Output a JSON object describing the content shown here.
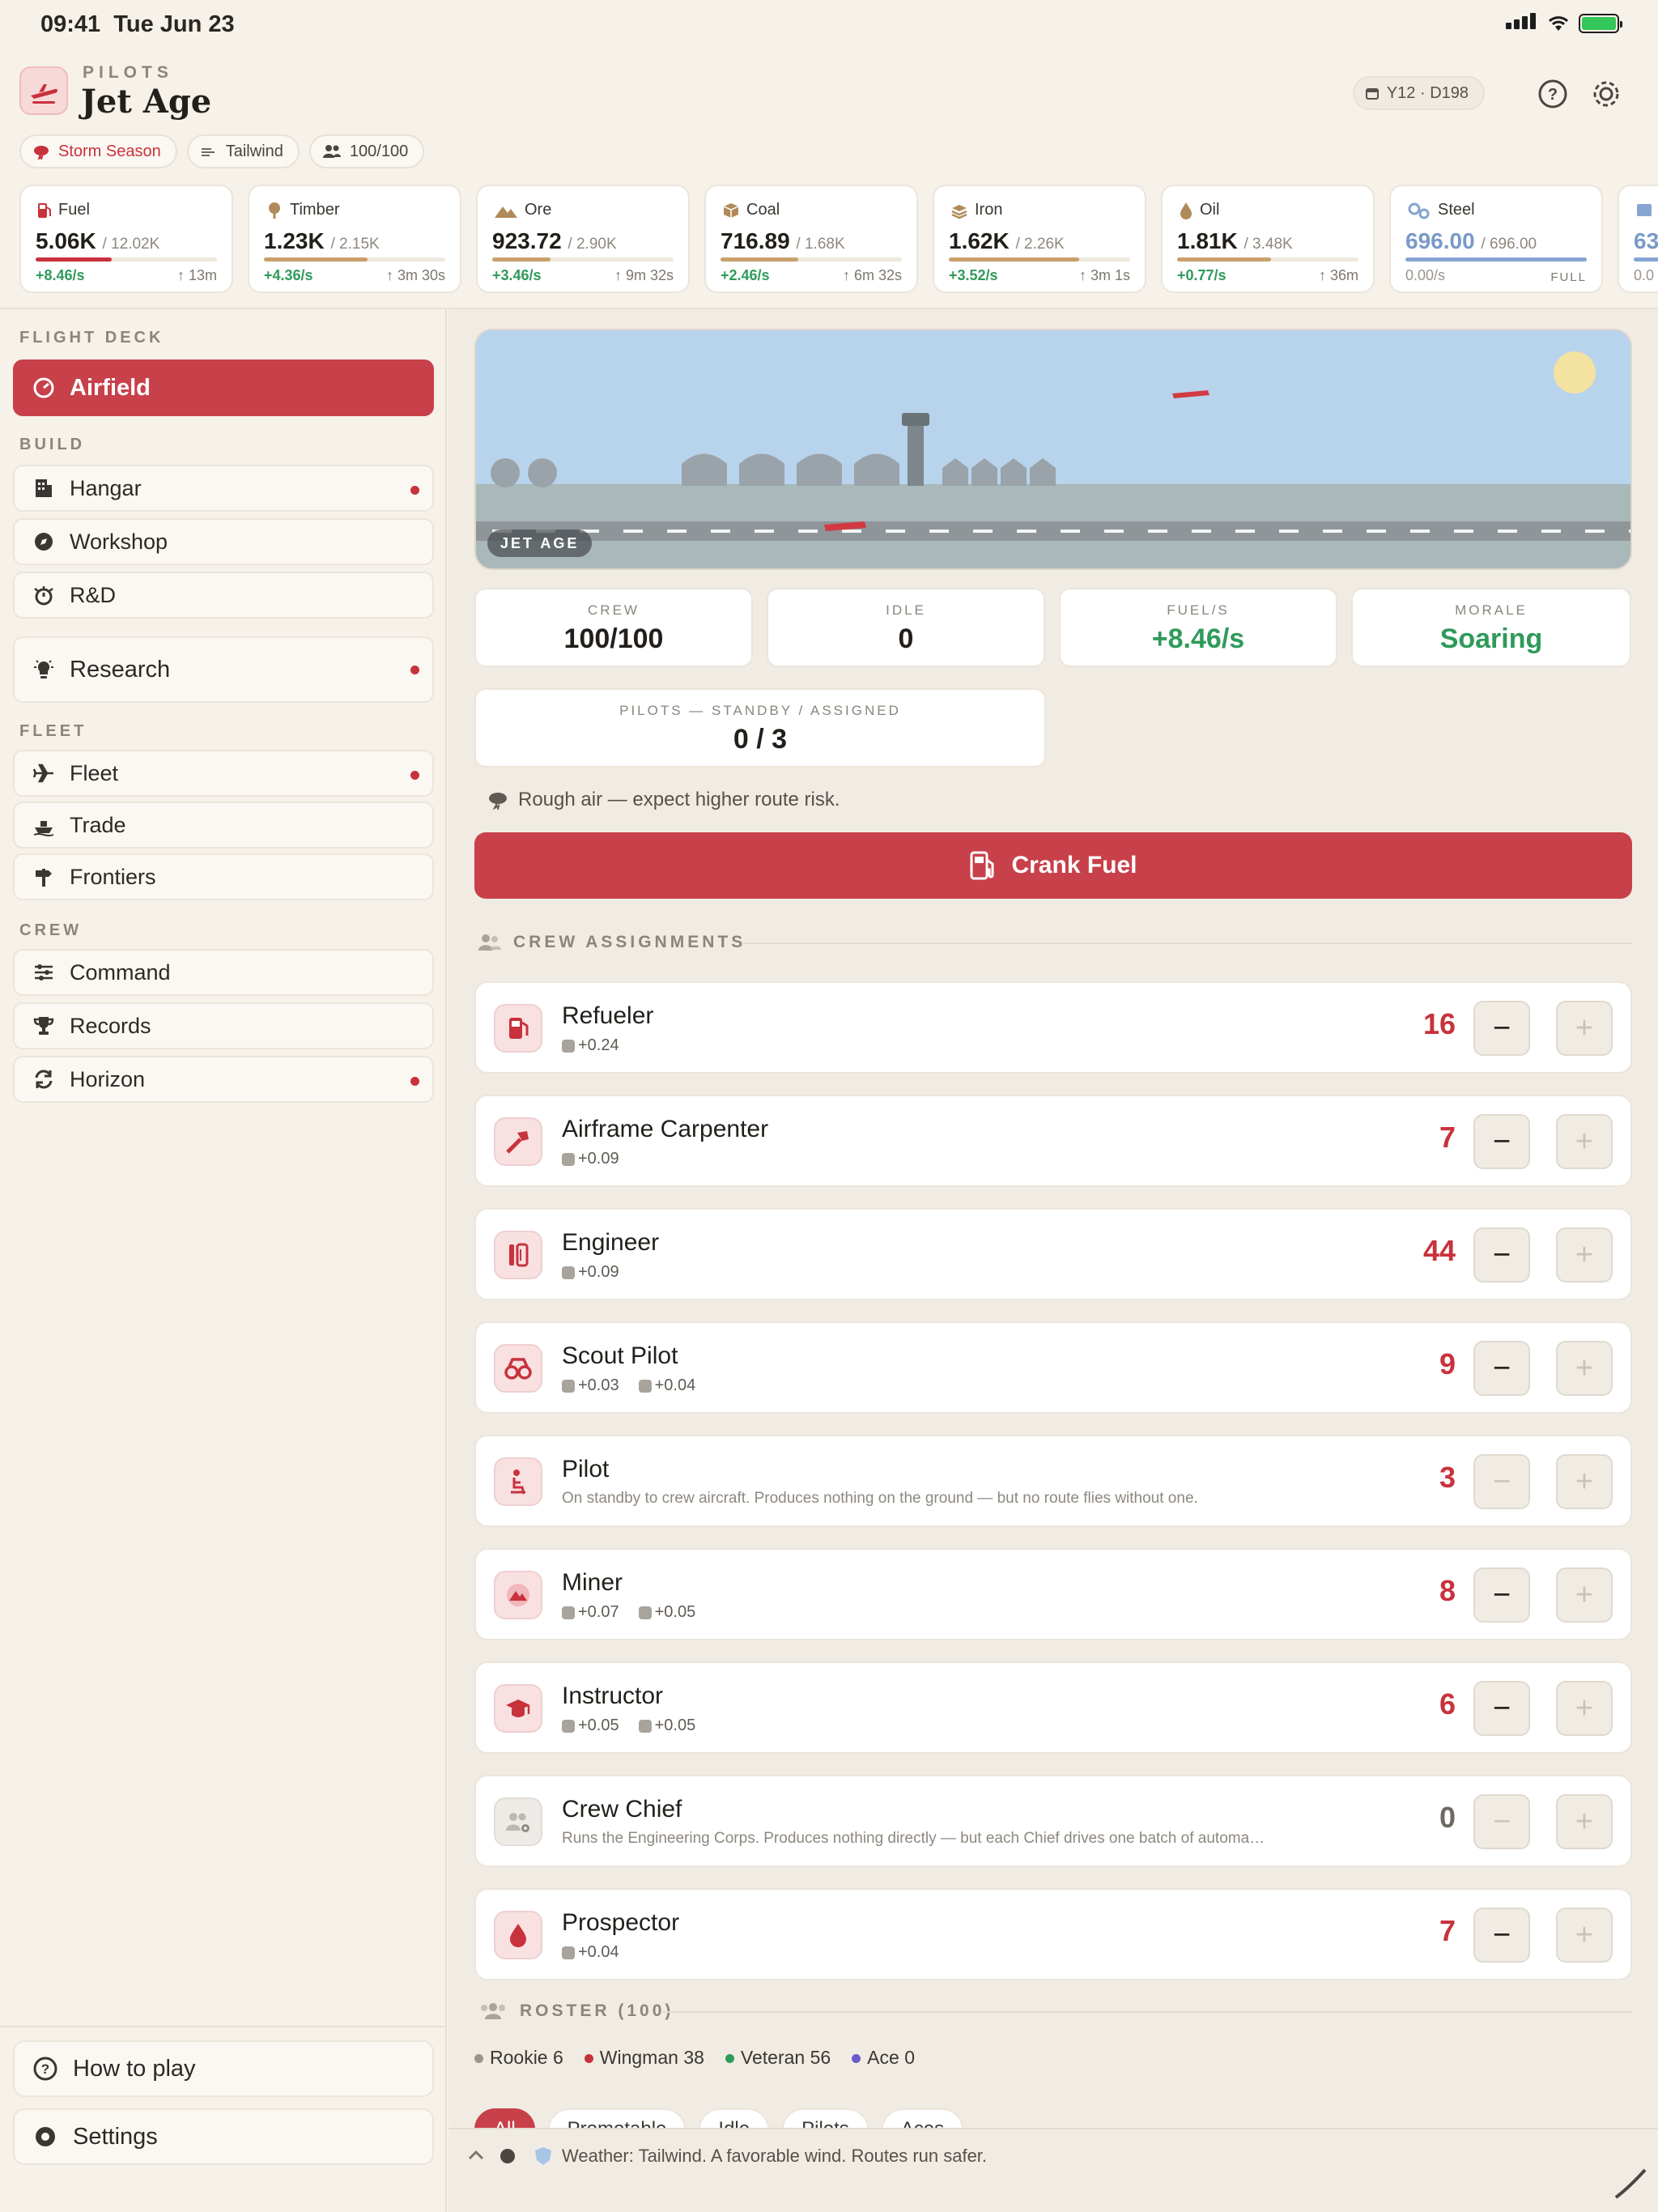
{
  "status": {
    "time": "09:41",
    "date": "Tue Jun 23"
  },
  "header": {
    "eyebrow": "PILOTS",
    "title": "Jet Age",
    "day": "Y12 · D198"
  },
  "pills": [
    {
      "label": "Storm Season"
    },
    {
      "label": "Tailwind"
    },
    {
      "label": "100/100"
    }
  ],
  "resources": [
    {
      "name": "Fuel",
      "amount": "5.06K",
      "cap": "/ 12.02K",
      "rate": "+8.46/s",
      "eta": "↑ 13m",
      "fill": 0.42,
      "color": "#c8323c"
    },
    {
      "name": "Timber",
      "amount": "1.23K",
      "cap": "/ 2.15K",
      "rate": "+4.36/s",
      "eta": "↑ 3m 30s",
      "fill": 0.57,
      "color": "#c9a06a"
    },
    {
      "name": "Ore",
      "amount": "923.72",
      "cap": "/ 2.90K",
      "rate": "+3.46/s",
      "eta": "↑ 9m 32s",
      "fill": 0.32,
      "color": "#c9a06a"
    },
    {
      "name": "Coal",
      "amount": "716.89",
      "cap": "/ 1.68K",
      "rate": "+2.46/s",
      "eta": "↑ 6m 32s",
      "fill": 0.43,
      "color": "#c9a06a"
    },
    {
      "name": "Iron",
      "amount": "1.62K",
      "cap": "/ 2.26K",
      "rate": "+3.52/s",
      "eta": "↑ 3m 1s",
      "fill": 0.72,
      "color": "#c9a06a"
    },
    {
      "name": "Oil",
      "amount": "1.81K",
      "cap": "/ 3.48K",
      "rate": "+0.77/s",
      "eta": "↑ 36m",
      "fill": 0.52,
      "color": "#c9a06a"
    },
    {
      "name": "Steel",
      "amount": "696.00",
      "cap": "/ 696.00",
      "rate": "0.00/s",
      "eta": "FULL",
      "fill": 1.0,
      "color": "#86a5d1"
    },
    {
      "name": "",
      "amount": "63",
      "cap": "",
      "rate": "0.0",
      "eta": "",
      "fill": 0.5,
      "color": "#86a5d1"
    }
  ],
  "sidebar": {
    "flight_deck_title": "FLIGHT DECK",
    "build_title": "BUILD",
    "fleet_title": "FLEET",
    "crew_title": "CREW",
    "airfield": "Airfield",
    "hangar": "Hangar",
    "workshop": "Workshop",
    "rnd": "R&D",
    "research": "Research",
    "fleet": "Fleet",
    "trade": "Trade",
    "frontiers": "Frontiers",
    "command": "Command",
    "records": "Records",
    "horizon": "Horizon",
    "how_to_play": "How to play",
    "settings": "Settings"
  },
  "scene": {
    "badge": "JET AGE"
  },
  "stats": {
    "crew_label": "CREW",
    "crew_value": "100/100",
    "idle_label": "IDLE",
    "idle_value": "0",
    "fuel_label": "FUEL/S",
    "fuel_value": "+8.46/s",
    "morale_label": "MORALE",
    "morale_value": "Soaring",
    "pilots_label": "PILOTS — STANDBY / ASSIGNED",
    "pilots_value": "0 / 3"
  },
  "weather_note": "Rough air — expect higher route risk.",
  "crank_label": "Crank Fuel",
  "assignments_title": "CREW ASSIGNMENTS",
  "jobs": [
    {
      "name": "Refueler",
      "effects": [
        "+0.24"
      ],
      "count": "16"
    },
    {
      "name": "Airframe Carpenter",
      "effects": [
        "+0.09"
      ],
      "count": "7"
    },
    {
      "name": "Engineer",
      "effects": [
        "+0.09"
      ],
      "count": "44"
    },
    {
      "name": "Scout Pilot",
      "effects": [
        "+0.03",
        "+0.04"
      ],
      "count": "9"
    },
    {
      "name": "Pilot",
      "desc": "On standby to crew aircraft. Produces nothing on the ground — but no route flies without one.",
      "count": "3"
    },
    {
      "name": "Miner",
      "effects": [
        "+0.07",
        "+0.05"
      ],
      "count": "8"
    },
    {
      "name": "Instructor",
      "effects": [
        "+0.05",
        "+0.05"
      ],
      "count": "6"
    },
    {
      "name": "Crew Chief",
      "desc": "Runs the Engineering Corps. Produces nothing directly — but each Chief drives one batch of automa…",
      "count": "0"
    },
    {
      "name": "Prospector",
      "effects": [
        "+0.04"
      ],
      "count": "7"
    }
  ],
  "roster": {
    "title": "ROSTER (100)",
    "legend": [
      {
        "label": "Rookie 6",
        "color": "#9a958c"
      },
      {
        "label": "Wingman 38",
        "color": "#c8323c"
      },
      {
        "label": "Veteran 56",
        "color": "#2f9a5a"
      },
      {
        "label": "Ace 0",
        "color": "#6a5acd"
      }
    ],
    "filters": [
      "All",
      "Promotable",
      "Idle",
      "Pilots",
      "Aces"
    ]
  },
  "ticker": "Weather: Tailwind. A favorable wind. Routes run safer."
}
